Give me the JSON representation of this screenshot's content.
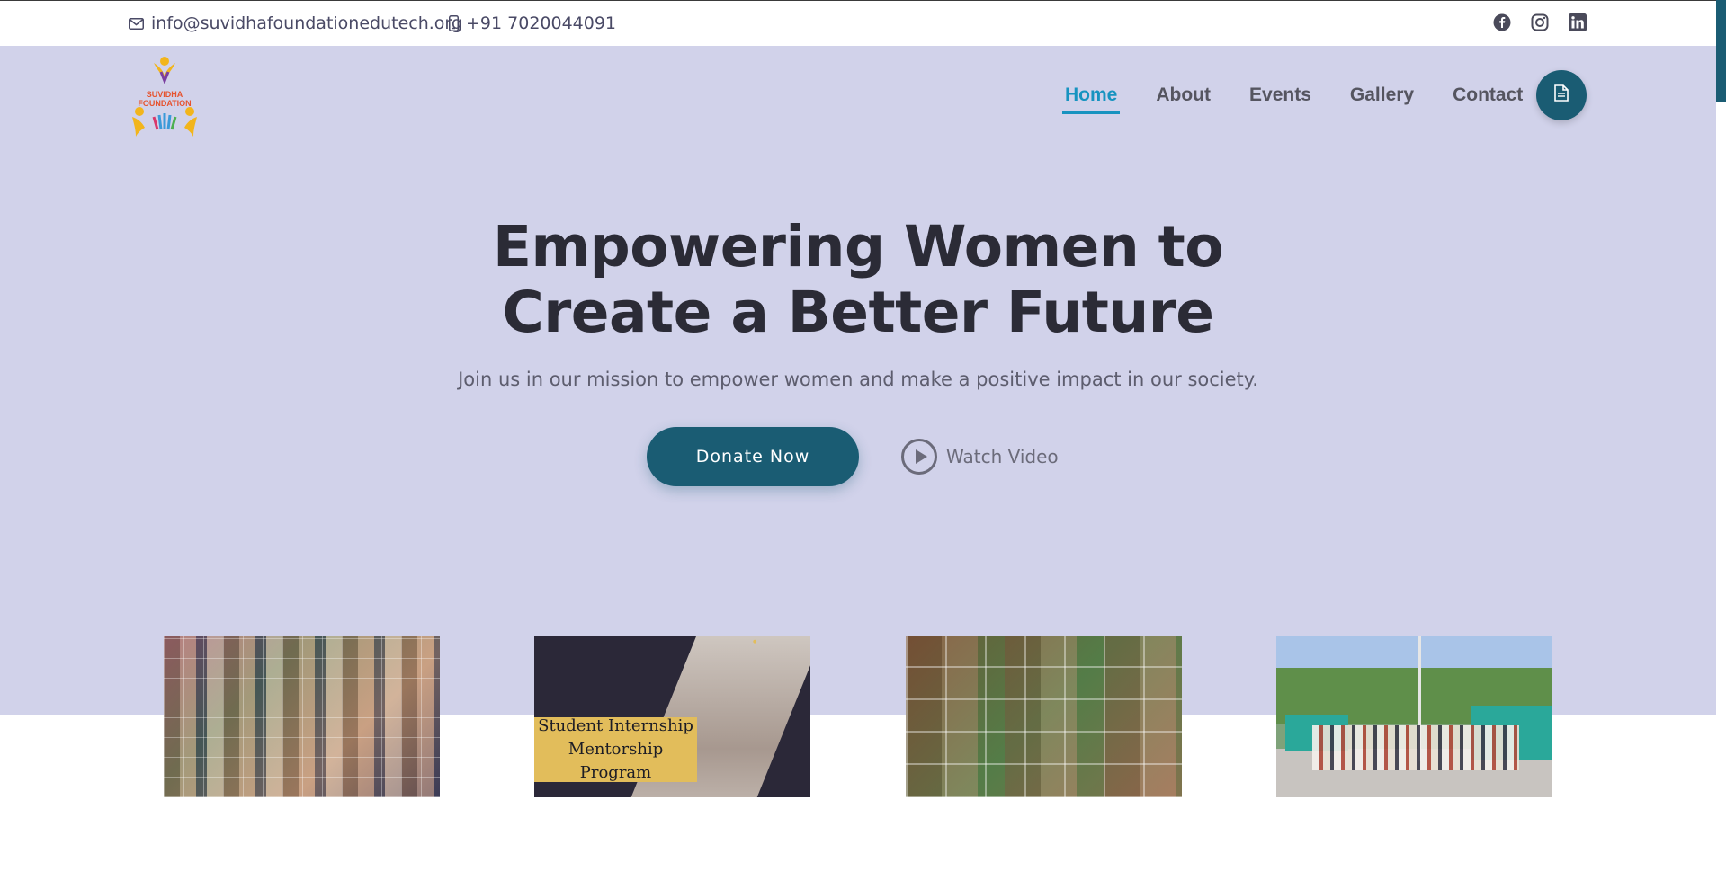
{
  "topbar": {
    "email": "info@suvidhafoundationedutech.org",
    "phone": "+91 7020044091",
    "social_icons": [
      "facebook-icon",
      "instagram-icon",
      "linkedin-icon"
    ]
  },
  "logo": {
    "text_line1": "SUVIDHA",
    "text_line2": "FOUNDATION"
  },
  "nav": {
    "items": [
      {
        "label": "Home",
        "active": true
      },
      {
        "label": "About",
        "active": false
      },
      {
        "label": "Events",
        "active": false
      },
      {
        "label": "Gallery",
        "active": false
      },
      {
        "label": "Contact",
        "active": false
      }
    ],
    "action_icon": "document-icon"
  },
  "hero": {
    "headline_line1": "Empowering Women to",
    "headline_line2": "Create a Better Future",
    "subtitle": "Join us in our mission to empower women and make a positive impact in our society.",
    "donate_label": "Donate Now",
    "watch_label": "Watch Video"
  },
  "cards": {
    "card2_tag_line1": "Student Internship",
    "card2_tag_line2": "Mentorship Program"
  },
  "colors": {
    "hero_bg": "#d1d2ea",
    "primary": "#1a5c73",
    "active_nav": "#1793c0",
    "tag_yellow": "#e2bd5b"
  }
}
